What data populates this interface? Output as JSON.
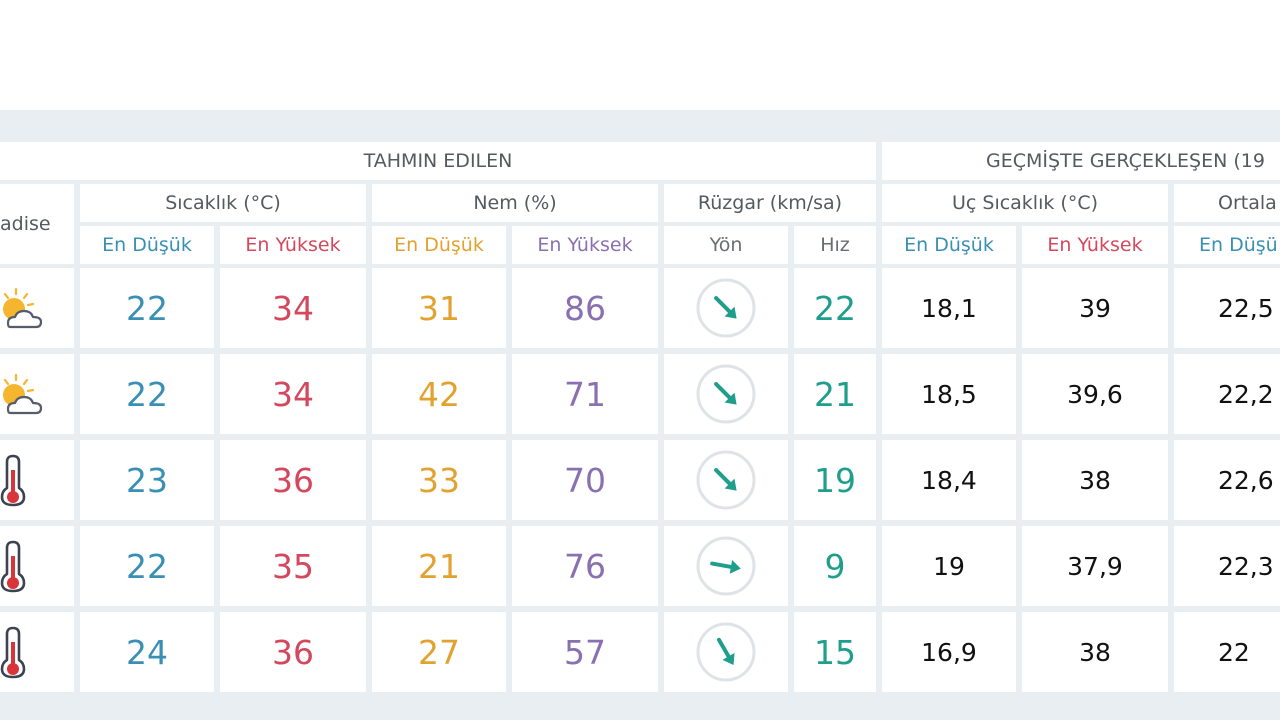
{
  "header": {
    "forecast_group": "TAHMIN EDILEN",
    "history_group": "GEÇMİŞTE GERÇEKLEŞEN (19",
    "event_label": "adise",
    "temperature_label": "Sıcaklık (°C)",
    "humidity_label": "Nem (%)",
    "wind_label": "Rüzgar (km/sa)",
    "extreme_temp_label": "Uç Sıcaklık (°C)",
    "average_label": "Ortala",
    "min_label": "En Düşük",
    "max_label": "En Yüksek",
    "direction_label": "Yön",
    "speed_label": "Hız",
    "avg_min_label": "En Düşü"
  },
  "colors": {
    "min": "#3a8fb4",
    "max": "#d4485e",
    "humidity_min": "#e2a230",
    "humidity_max": "#8a70b0",
    "wind_speed": "#1f9e8c",
    "wind_arrow": "#1f9e8c",
    "header_text": "#555a5f",
    "panel_bg": "#e9eef3"
  },
  "rows": [
    {
      "icon": "partly-cloudy-icon",
      "temp_min": "22",
      "temp_max": "34",
      "hum_min": "31",
      "hum_max": "86",
      "wind_dir_deg": 135,
      "wind_speed": "22",
      "hist_min": "18,1",
      "hist_max": "39",
      "avg_min": "22,5"
    },
    {
      "icon": "partly-cloudy-icon",
      "temp_min": "22",
      "temp_max": "34",
      "hum_min": "42",
      "hum_max": "71",
      "wind_dir_deg": 135,
      "wind_speed": "21",
      "hist_min": "18,5",
      "hist_max": "39,6",
      "avg_min": "22,2"
    },
    {
      "icon": "thermometer-icon",
      "temp_min": "23",
      "temp_max": "36",
      "hum_min": "33",
      "hum_max": "70",
      "wind_dir_deg": 135,
      "wind_speed": "19",
      "hist_min": "18,4",
      "hist_max": "38",
      "avg_min": "22,6"
    },
    {
      "icon": "thermometer-icon",
      "temp_min": "22",
      "temp_max": "35",
      "hum_min": "21",
      "hum_max": "76",
      "wind_dir_deg": 100,
      "wind_speed": "9",
      "hist_min": "19",
      "hist_max": "37,9",
      "avg_min": "22,3"
    },
    {
      "icon": "thermometer-icon",
      "temp_min": "24",
      "temp_max": "36",
      "hum_min": "27",
      "hum_max": "57",
      "wind_dir_deg": 150,
      "wind_speed": "15",
      "hist_min": "16,9",
      "hist_max": "38",
      "avg_min": "22"
    }
  ]
}
